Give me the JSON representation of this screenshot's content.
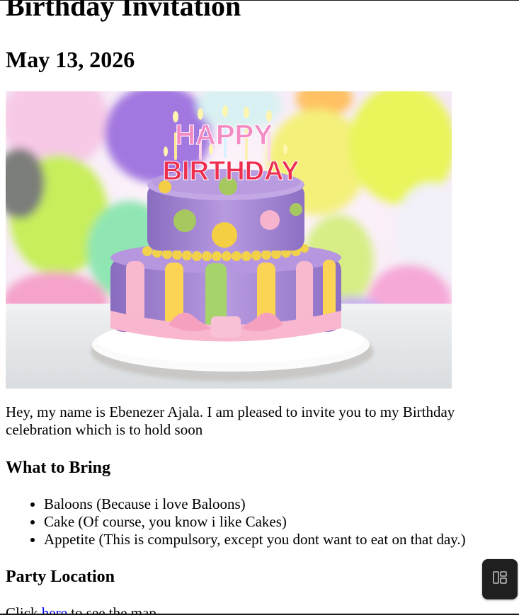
{
  "page": {
    "title": "Birthday Invitation",
    "date": "May 13, 2026"
  },
  "hero_image": {
    "alt": "Birthday cake",
    "cake_text_top": "HAPPY",
    "cake_text_bottom": "BIRTHDAY"
  },
  "intro": {
    "text": "Hey, my name is Ebenezer Ajala. I am pleased to invite you to my Birthday celebration which is to hold soon"
  },
  "bring": {
    "heading": "What to Bring",
    "items": [
      "Baloons (Because i love Baloons)",
      "Cake (Of course, you know i like Cakes)",
      "Appetite (This is compulsory, except you dont want to eat on that day.)"
    ]
  },
  "location": {
    "heading": "Party Location",
    "before_link": "Click ",
    "link_text": "here",
    "after_link": " to see the map"
  },
  "widget": {
    "icon": "layout-panel-icon"
  },
  "colors": {
    "link": "#0000ee",
    "widget_bg": "#1f1f1f"
  }
}
